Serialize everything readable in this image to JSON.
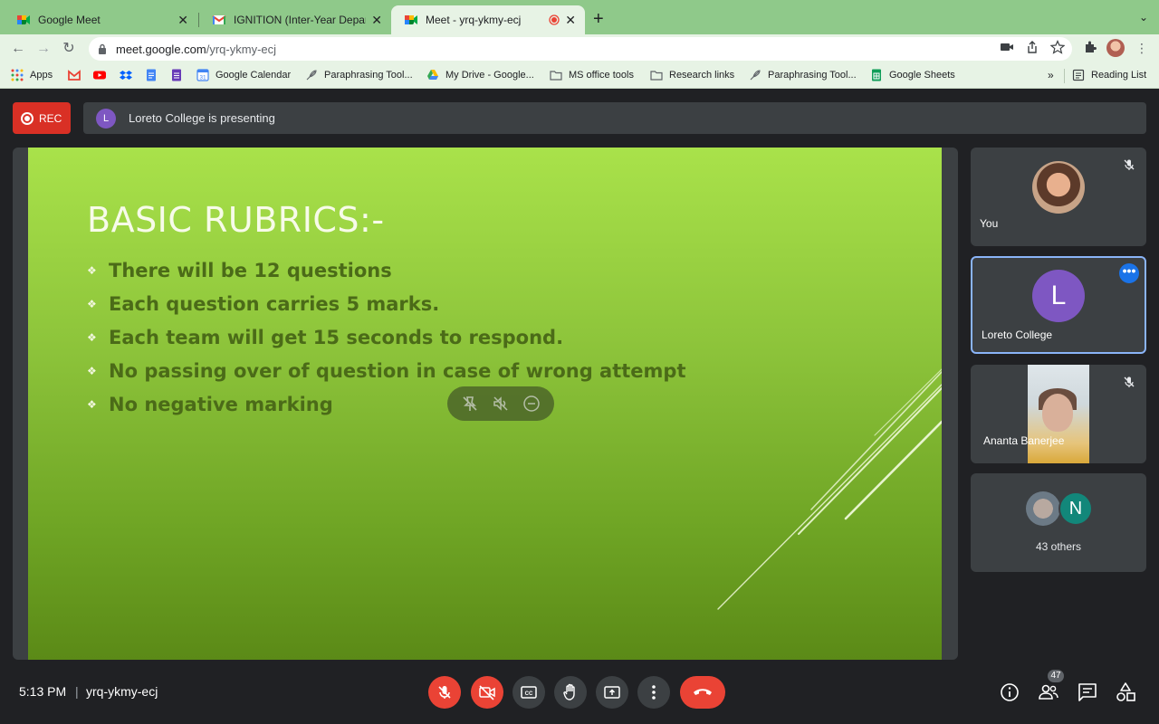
{
  "browser": {
    "tabs": [
      {
        "title": "Google Meet",
        "favicon": "meet-icon"
      },
      {
        "title": "IGNITION (Inter-Year Departme",
        "favicon": "gmail-icon"
      },
      {
        "title": "Meet - yrq-ykmy-ecj",
        "favicon": "meet-icon",
        "recording": true
      }
    ],
    "url_host": "meet.google.com",
    "url_path": "/yrq-ykmy-ecj",
    "bookmarks": [
      {
        "label": "Apps",
        "icon": "apps-grid-icon"
      },
      {
        "label": "",
        "icon": "gmail-icon"
      },
      {
        "label": "",
        "icon": "youtube-icon"
      },
      {
        "label": "",
        "icon": "dropbox-icon"
      },
      {
        "label": "",
        "icon": "docs-icon"
      },
      {
        "label": "",
        "icon": "forms-icon"
      },
      {
        "label": "Google Calendar",
        "icon": "calendar-icon"
      },
      {
        "label": "Paraphrasing Tool...",
        "icon": "feather-icon"
      },
      {
        "label": "My Drive - Google...",
        "icon": "drive-icon"
      },
      {
        "label": "MS office tools",
        "icon": "folder-icon"
      },
      {
        "label": "Research links",
        "icon": "folder-icon"
      },
      {
        "label": "Paraphrasing Tool...",
        "icon": "feather-icon"
      },
      {
        "label": "Google Sheets",
        "icon": "sheets-icon"
      }
    ],
    "more": "»",
    "reading_list": "Reading List"
  },
  "meet": {
    "rec_label": "REC",
    "presenting_avatar": "L",
    "presenting_text": "Loreto College is presenting",
    "slide": {
      "title": "BASIC RUBRICS:-",
      "bullets": [
        "There will be 12 questions",
        "Each question carries 5 marks.",
        "Each team will get 15 seconds to respond.",
        "No passing over of question in case of wrong attempt",
        "No negative marking"
      ]
    },
    "participants": {
      "you": "You",
      "presenter": "Loreto College",
      "presenter_initial": "L",
      "third": "Ananta Banerjee",
      "others_initial": "N",
      "others_label": "43 others"
    },
    "bottom": {
      "time": "5:13 PM",
      "separator": "|",
      "meeting_code": "yrq-ykmy-ecj",
      "people_count": "47"
    }
  },
  "colors": {
    "tab_bar": "#8fc98a",
    "toolbar": "#e7f3e5",
    "rec": "#d93025",
    "hangup": "#ea4335",
    "presenter_avatar": "#7e57c2",
    "slide_green": "#8cc33a"
  }
}
